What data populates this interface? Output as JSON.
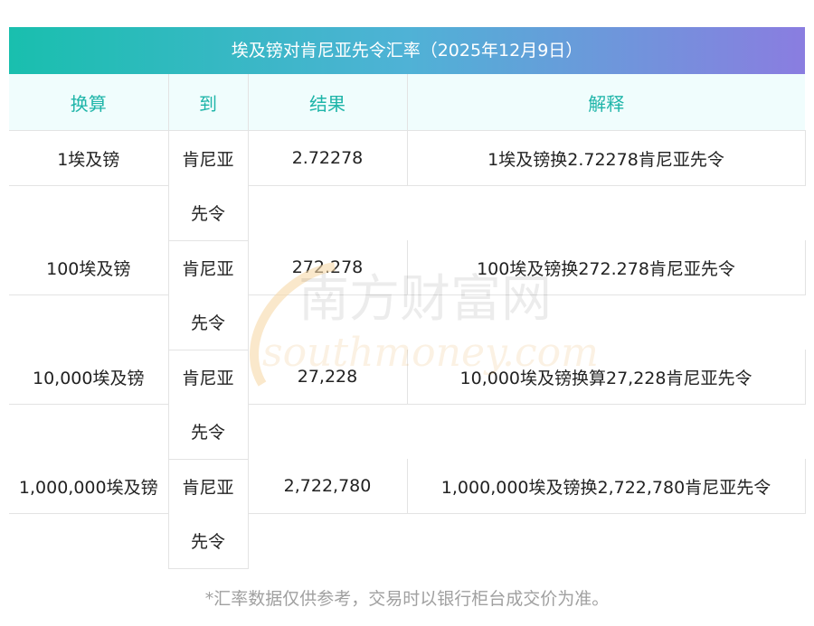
{
  "title": "埃及镑对肯尼亚先令汇率（2025年12月9日）",
  "headers": [
    "换算",
    "到",
    "结果",
    "解释"
  ],
  "rows": [
    {
      "from": "1埃及镑",
      "to": "肯尼亚先令",
      "to_line1": "肯尼亚",
      "to_line2": "先令",
      "result": "2.72278",
      "explain": "1埃及镑换2.72278肯尼亚先令"
    },
    {
      "from": "100埃及镑",
      "to": "肯尼亚先令",
      "to_line1": "肯尼亚",
      "to_line2": "先令",
      "result": "272.278",
      "explain": "100埃及镑换272.278肯尼亚先令"
    },
    {
      "from": "10,000埃及镑",
      "to": "肯尼亚先令",
      "to_line1": "肯尼亚",
      "to_line2": "先令",
      "result": "27,228",
      "explain": "10,000埃及镑换算27,228肯尼亚先令"
    },
    {
      "from": "1,000,000埃及镑",
      "to": "肯尼亚先令",
      "to_line1": "肯尼亚",
      "to_line2": "先令",
      "result": "2,722,780",
      "explain": "1,000,000埃及镑换2,722,780肯尼亚先令"
    }
  ],
  "note": "*汇率数据仅供参考，交易时以银行柜台成交价为准。",
  "watermark": {
    "cn": "南方财富网",
    "en": "southmoney.com"
  },
  "colors": {
    "header_start": "#19bfae",
    "header_end": "#8a7de0",
    "accent": "#1fb5a9"
  }
}
